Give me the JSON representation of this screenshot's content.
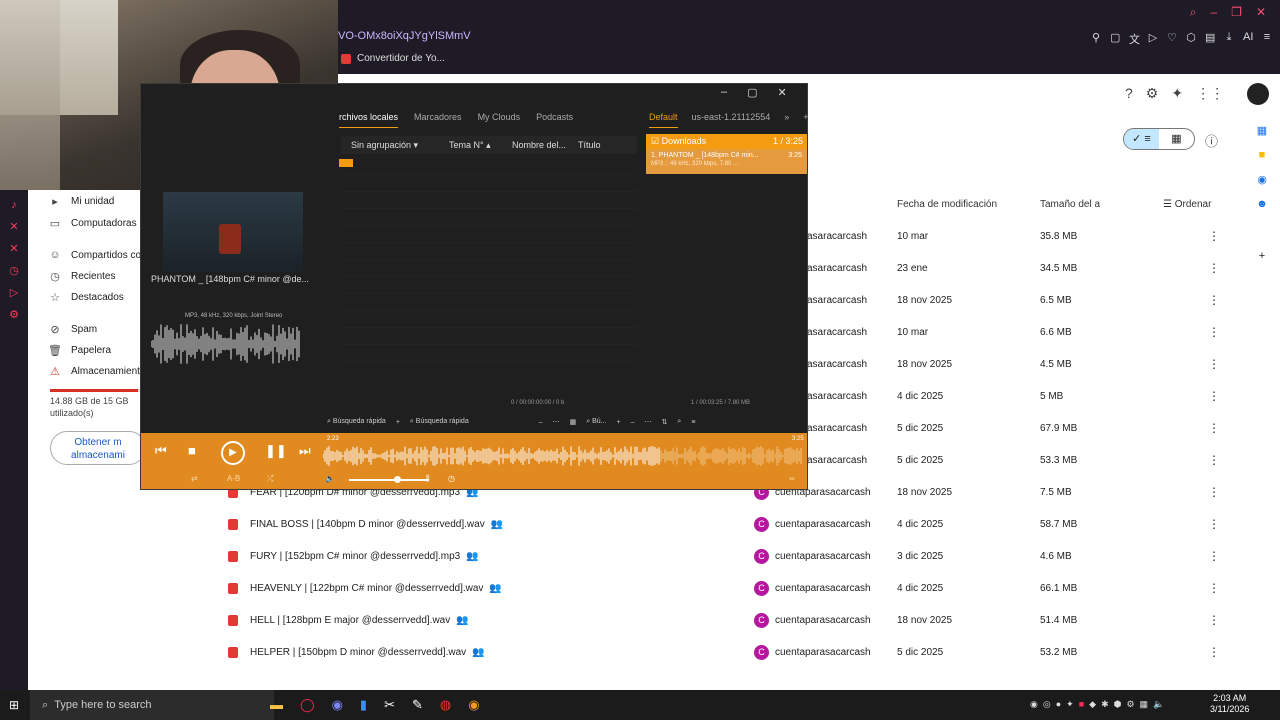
{
  "browser": {
    "address_fragment": "VO-OMx8oiXqJYgYlSMmV",
    "bookmark_label": "Convertidor de Yo...",
    "toolbar_ai_label": "AI"
  },
  "drive": {
    "sidebar": [
      {
        "icon": "drive-icon",
        "label": "Mi unidad"
      },
      {
        "icon": "computer-icon",
        "label": "Computadoras"
      },
      {
        "icon": "shared-icon",
        "label": "Compartidos co"
      },
      {
        "icon": "clock-icon",
        "label": "Recientes"
      },
      {
        "icon": "star-icon",
        "label": "Destacados"
      },
      {
        "icon": "spam-icon",
        "label": "Spam"
      },
      {
        "icon": "trash-icon",
        "label": "Papelera"
      },
      {
        "icon": "cloud-icon",
        "label": "Almacenamient"
      }
    ],
    "storage_text": "14.88 GB de 15 GB utilizado(s)",
    "get_storage_label": "Obtener m almacenami",
    "columns": {
      "modified": "Fecha de modificación",
      "size": "Tamaño del a",
      "sort": "Ordenar"
    },
    "rows": [
      {
        "name": "",
        "owner": "asaracarcash",
        "date": "10 mar",
        "size": "35.8 MB"
      },
      {
        "name": "",
        "owner": "asaracarcash",
        "date": "23 ene",
        "size": "34.5 MB"
      },
      {
        "name": "",
        "owner": "asaracarcash",
        "date": "18 nov 2025",
        "size": "6.5 MB"
      },
      {
        "name": "",
        "owner": "asaracarcash",
        "date": "10 mar",
        "size": "6.6 MB"
      },
      {
        "name": "",
        "owner": "asaracarcash",
        "date": "18 nov 2025",
        "size": "4.5 MB"
      },
      {
        "name": "",
        "owner": "asaracarcash",
        "date": "4 dic 2025",
        "size": "5 MB"
      },
      {
        "name": "",
        "owner": "asaracarcash",
        "date": "5 dic 2025",
        "size": "67.9 MB"
      },
      {
        "name": "",
        "owner": "asaracarcash",
        "date": "5 dic 2025",
        "size": "53.3 MB"
      },
      {
        "name": "FEAR | [120bpm D# minor @desserrvedd].mp3",
        "owner": "cuentaparasacarcash",
        "date": "18 nov 2025",
        "size": "7.5 MB"
      },
      {
        "name": "FINAL BOSS | [140bpm D minor @desserrvedd].wav",
        "owner": "cuentaparasacarcash",
        "date": "4 dic 2025",
        "size": "58.7 MB"
      },
      {
        "name": "FURY |  [152bpm C# minor @desserrvedd].mp3",
        "owner": "cuentaparasacarcash",
        "date": "3 dic 2025",
        "size": "4.6 MB"
      },
      {
        "name": "HEAVENLY | [122bpm C# minor @desserrvedd].wav",
        "owner": "cuentaparasacarcash",
        "date": "4 dic 2025",
        "size": "66.1 MB"
      },
      {
        "name": "HELL | [128bpm E major @desserrvedd].wav",
        "owner": "cuentaparasacarcash",
        "date": "18 nov 2025",
        "size": "51.4 MB"
      },
      {
        "name": "HELPER | [150bpm D minor @desserrvedd].wav",
        "owner": "cuentaparasacarcash",
        "date": "5 dic 2025",
        "size": "53.2 MB"
      }
    ],
    "owner_initial": "C"
  },
  "player": {
    "tabs": [
      "rchivos locales",
      "Marcadores",
      "My Clouds",
      "Podcasts"
    ],
    "right_tabs": [
      "Default",
      "us-east-1.21112554"
    ],
    "columns": [
      "Sin agrupación",
      "Tema N°",
      "Nombre del...",
      "Título"
    ],
    "now_playing_title": "PHANTOM _ [148bpm C# minor @de...",
    "now_playing_meta": "MP3, 48 kHz, 320 kbps, Joint Stereo",
    "playlist_name": "Downloads",
    "playlist_count": "1 / 3:25",
    "playlist_item": "1. PHANTOM _ [148bpm C# min...",
    "playlist_item_time": "3:25",
    "playlist_item_meta": "MP3 :: 48 kHz, 320 kbps, 7.80 ...",
    "status_left": "0 / 00:00:00:00 / 0 b",
    "status_right": "1 / 00:03:25 / 7.80 MB",
    "quick_search": "Búsqueda rápida",
    "quick_search_2": "Búsqueda rápida",
    "quick_search_3": "Bú...",
    "time_elapsed": "2:23",
    "time_total": "3:25",
    "ab_label": "A-B",
    "progress_fraction": 0.7,
    "volume_fraction": 0.6
  },
  "taskbar": {
    "search_placeholder": "Type here to search",
    "time": "2:03 AM",
    "date": "3/11/2026"
  }
}
